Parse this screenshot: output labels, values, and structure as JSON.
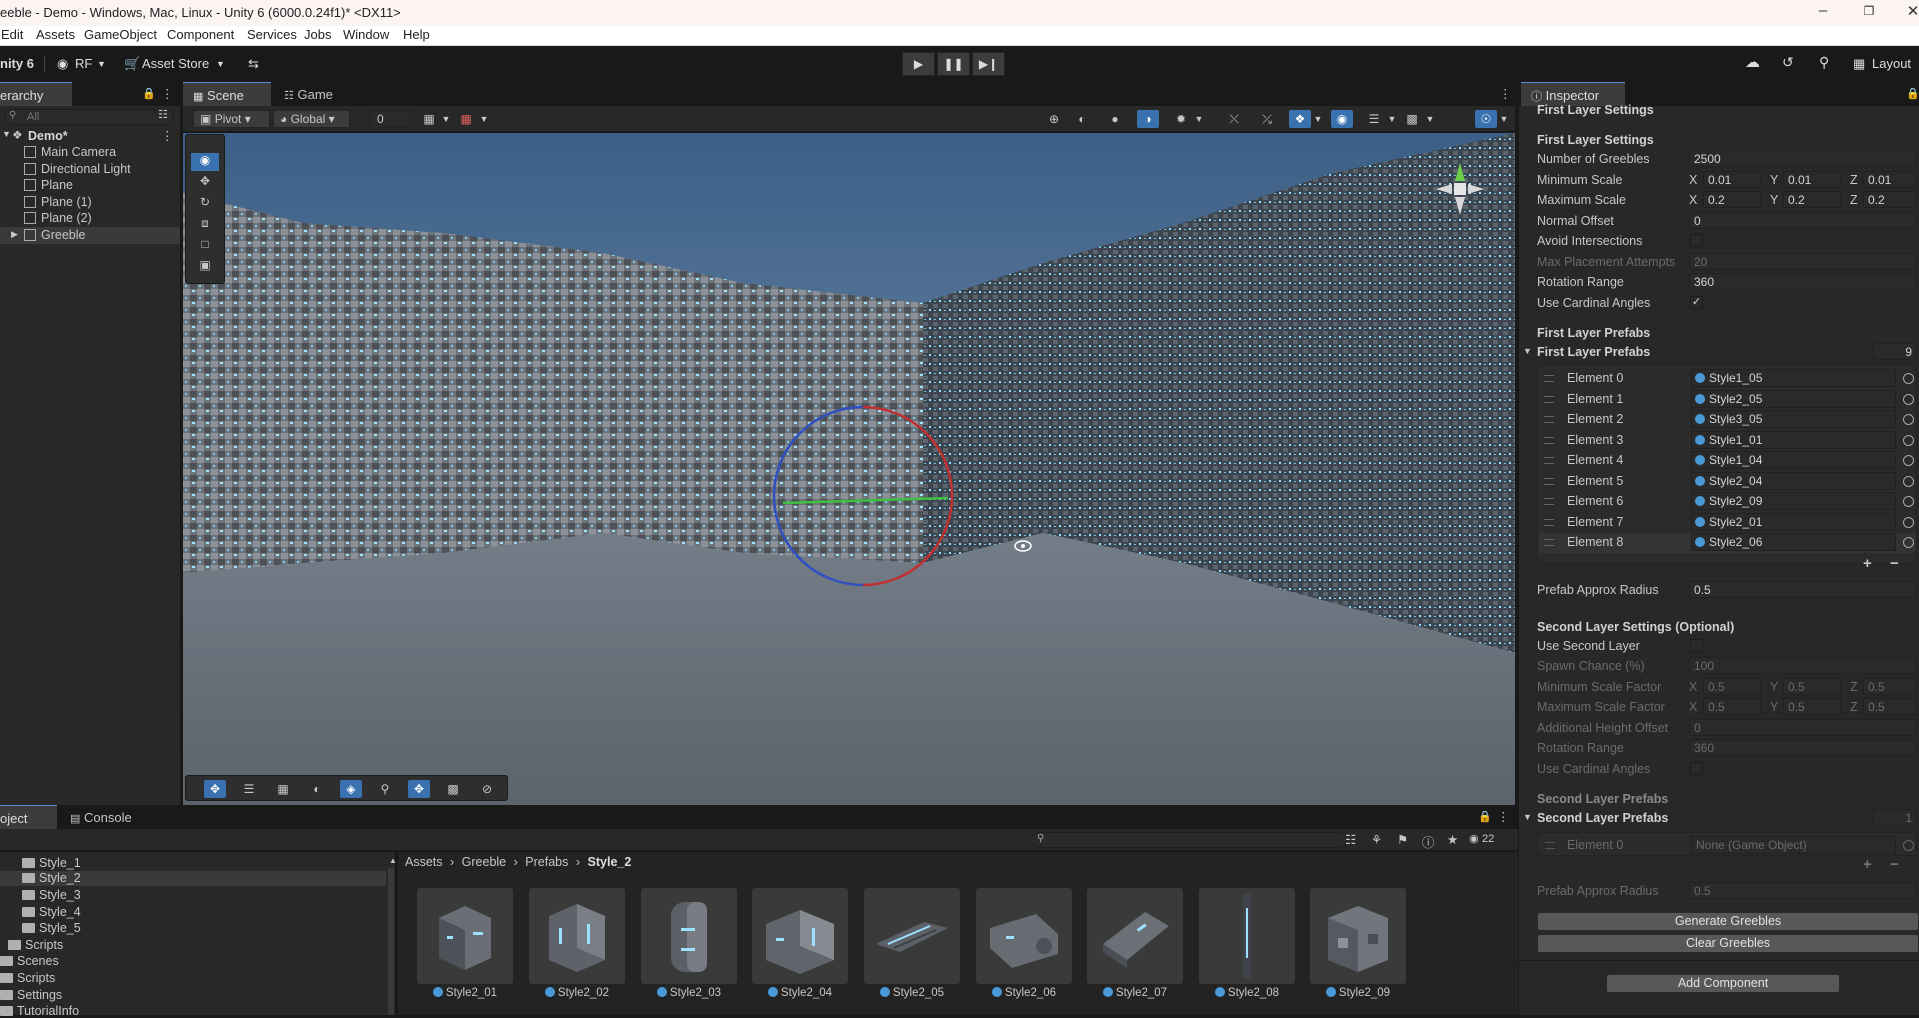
{
  "titlebar": {
    "title": "eeble - Demo - Windows, Mac, Linux - Unity 6 (6000.0.24f1)* <DX11>"
  },
  "menu": [
    "Edit",
    "Assets",
    "GameObject",
    "Component",
    "Services",
    "Jobs",
    "Window",
    "Help"
  ],
  "toolbar": {
    "unity_label": "nity 6",
    "account": "RF",
    "asset_store": "Asset Store",
    "layout": "Layout"
  },
  "hierarchy": {
    "tab": "erarchy",
    "search_placeholder": "All",
    "scene": "Demo*",
    "items": [
      "Main Camera",
      "Directional Light",
      "Plane",
      "Plane (1)",
      "Plane (2)",
      "Greeble"
    ]
  },
  "scene_tabs": {
    "scene": "Scene",
    "game": "Game"
  },
  "scene_toolbar": {
    "pivot": "Pivot",
    "global": "Global",
    "snap_value": "0"
  },
  "inspector": {
    "tab": "Inspector",
    "top_header": "First Layer Settings",
    "first_settings_header": "First Layer Settings",
    "number_of_greebles": {
      "label": "Number of Greebles",
      "value": "2500"
    },
    "min_scale": {
      "label": "Minimum Scale",
      "x": "0.01",
      "y": "0.01",
      "z": "0.01"
    },
    "max_scale": {
      "label": "Maximum Scale",
      "x": "0.2",
      "y": "0.2",
      "z": "0.2"
    },
    "normal_offset": {
      "label": "Normal Offset",
      "value": "0"
    },
    "avoid_intersections": {
      "label": "Avoid Intersections"
    },
    "max_attempts": {
      "label": "Max Placement Attempts",
      "value": "20"
    },
    "rotation_range": {
      "label": "Rotation Range",
      "value": "360"
    },
    "use_cardinal": {
      "label": "Use Cardinal Angles"
    },
    "first_prefabs_header": "First Layer Prefabs",
    "first_prefabs_list": {
      "label": "First Layer Prefabs",
      "count": "9"
    },
    "elements": [
      {
        "label": "Element 0",
        "value": "Style1_05"
      },
      {
        "label": "Element 1",
        "value": "Style2_05"
      },
      {
        "label": "Element 2",
        "value": "Style3_05"
      },
      {
        "label": "Element 3",
        "value": "Style1_01"
      },
      {
        "label": "Element 4",
        "value": "Style1_04"
      },
      {
        "label": "Element 5",
        "value": "Style2_04"
      },
      {
        "label": "Element 6",
        "value": "Style2_09"
      },
      {
        "label": "Element 7",
        "value": "Style2_01"
      },
      {
        "label": "Element 8",
        "value": "Style2_06"
      }
    ],
    "prefab_radius": {
      "label": "Prefab Approx Radius",
      "value": "0.5"
    },
    "second_settings_header": "Second Layer Settings (Optional)",
    "use_second": {
      "label": "Use Second Layer"
    },
    "spawn_chance": {
      "label": "Spawn Chance (%)",
      "value": "100"
    },
    "min_scale_factor": {
      "label": "Minimum Scale Factor",
      "x": "0.5",
      "y": "0.5",
      "z": "0.5"
    },
    "max_scale_factor": {
      "label": "Maximum Scale Factor",
      "x": "0.5",
      "y": "0.5",
      "z": "0.5"
    },
    "add_height": {
      "label": "Additional Height Offset",
      "value": "0"
    },
    "rotation_range2": {
      "label": "Rotation Range",
      "value": "360"
    },
    "use_cardinal2": {
      "label": "Use Cardinal Angles"
    },
    "second_prefabs_header": "Second Layer Prefabs",
    "second_prefabs_list": {
      "label": "Second Layer Prefabs",
      "count": "1"
    },
    "second_element": {
      "label": "Element 0",
      "value": "None (Game Object)"
    },
    "prefab_radius2": {
      "label": "Prefab Approx Radius",
      "value": "0.5"
    },
    "generate_button": "Generate Greebles",
    "clear_button": "Clear Greebles",
    "add_component": "Add Component",
    "x": "X",
    "y": "Y",
    "z": "Z",
    "plus": "+",
    "minus": "−"
  },
  "project": {
    "tab": "oject",
    "console_tab": "Console",
    "folders": [
      "Style_1",
      "Style_2",
      "Style_3",
      "Style_4",
      "Style_5",
      "Scripts",
      "Scenes",
      "Scripts",
      "Settings",
      "TutorialInfo"
    ],
    "breadcrumb": [
      "Assets",
      "Greeble",
      "Prefabs",
      "Style_2"
    ],
    "assets": [
      "Style2_01",
      "Style2_02",
      "Style2_03",
      "Style2_04",
      "Style2_05",
      "Style2_06",
      "Style2_07",
      "Style2_08",
      "Style2_09"
    ],
    "asset_count": "22"
  }
}
